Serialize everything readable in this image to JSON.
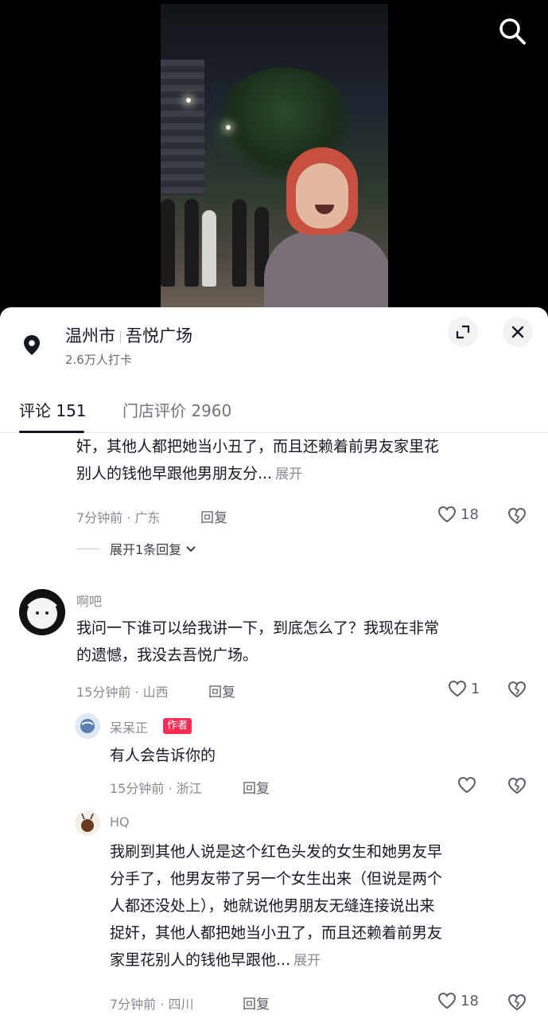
{
  "header": {
    "location": {
      "city": "温州市",
      "place": "吾悦广场",
      "checkins": "2.6万人打卡"
    }
  },
  "tabs": [
    {
      "label": "评论 151",
      "active": true
    },
    {
      "label": "门店评价 2960",
      "active": false
    }
  ],
  "comments": [
    {
      "text_lines": [
        "奸，其他人都把她当小丑了，而且还赖着前男友家里花",
        "别人的钱他早跟他男朋友分..."
      ],
      "expand_label": "展开",
      "meta": "7分钟前 · 广东",
      "reply_label": "回复",
      "likes": "18",
      "expand_replies": "展开1条回复"
    },
    {
      "username": "啊吧",
      "text_lines": [
        "我问一下谁可以给我讲一下，到底怎么了？我现在非常",
        "的遗憾，我没去吾悦广场。"
      ],
      "meta": "15分钟前 · 山西",
      "reply_label": "回复",
      "likes": "1",
      "replies": [
        {
          "username": "呆呆正",
          "badge": "作者",
          "text_lines": [
            "有人会告诉你的"
          ],
          "meta": "15分钟前 · 浙江",
          "reply_label": "回复"
        },
        {
          "username": "HQ",
          "text_lines": [
            "我刷到其他人说是这个红色头发的女生和她男友早",
            "分手了，他男友带了另一个女生出来（但说是两个",
            "人都还没处上），她就说他男朋友无缝连接说出来",
            "捉奸，其他人都把她当小丑了，而且还赖着前男友",
            "家里花别人的钱他早跟他..."
          ],
          "expand_label": "展开",
          "meta": "7分钟前 · 四川",
          "reply_label": "回复",
          "likes": "18"
        }
      ]
    }
  ],
  "icons": [
    "search-icon",
    "location-pin-icon",
    "minimize-icon",
    "close-icon",
    "heart-icon",
    "broken-heart-icon",
    "chevron-down-icon"
  ],
  "colors": {
    "accent_badge": "#fe2c55",
    "text_primary": "#161823",
    "text_secondary": "#8a8b91"
  }
}
